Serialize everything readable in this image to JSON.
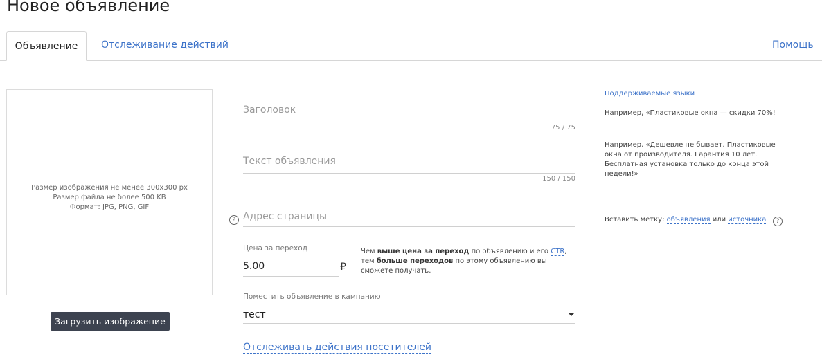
{
  "page": {
    "title": "Новое объявление"
  },
  "tabs": {
    "active": "Объявление",
    "tracking": "Отслеживание действий",
    "help": "Помощь"
  },
  "image": {
    "hint_lines": [
      "Размер изображения не менее 300x300 px",
      "Размер файла не более 500 KB",
      "Формат: JPG, PNG, GIF"
    ],
    "upload_label": "Загрузить изображение"
  },
  "form": {
    "headline_placeholder": "Заголовок",
    "headline_counter": "75 / 75",
    "text_placeholder": "Текст объявления",
    "text_counter": "150 / 150",
    "url_placeholder": "Адрес страницы",
    "help_icon": "?",
    "price_label": "Цена за переход",
    "price_value": "5.00",
    "currency": "₽",
    "price_note": {
      "p1": "Чем ",
      "b1": "выше цена за переход",
      "p2": " по объявлению и его ",
      "link": "CTR",
      "p3": ", тем ",
      "b2": "больше переходов",
      "p4": " по этому объявлению вы сможете получать."
    },
    "campaign_label": "Поместить объявление в кампанию",
    "campaign_value": "тест",
    "track_link": "Отслеживать действия посетителей"
  },
  "sidebar": {
    "languages_link": "Поддерживаемые языки",
    "example1": "Например, «Пластиковые окна — скидки 70%!",
    "example2": "Например, «Дешевле не бывает. Пластиковые окна от производителя. Гарантия 10 лет. Бесплатная установка только до конца этой недели!»",
    "insert_label": "Вставить метку:",
    "insert_link1": "объявления",
    "insert_or": "или",
    "insert_link2": "источника"
  },
  "colors": {
    "link": "#3d73c9",
    "button_bg": "#3d4350"
  },
  "icons": {
    "help": "question-circle-icon",
    "dropdown": "caret-down-icon"
  }
}
